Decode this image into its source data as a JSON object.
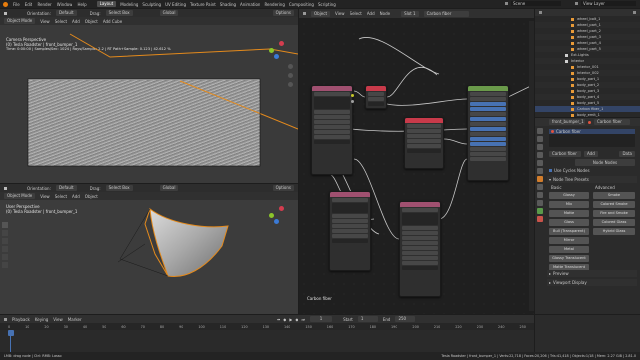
{
  "topbar": {
    "menus": [
      "File",
      "Edit",
      "Render",
      "Window",
      "Help"
    ],
    "workspaces": [
      "Layout",
      "Modeling",
      "Sculpting",
      "UV Editing",
      "Texture Paint",
      "Shading",
      "Animation",
      "Rendering",
      "Compositing",
      "Scripting"
    ],
    "active_workspace": "Layout",
    "scene": "Scene",
    "view_layer": "View Layer"
  },
  "viewport_top": {
    "orientation_label": "Orientation:",
    "orientation_value": "Default",
    "drag_label": "Drag:",
    "select_box": "Select Box",
    "global": "Global",
    "options": "Options",
    "mode": "Object Mode",
    "menus": [
      "View",
      "Select",
      "Add",
      "Object"
    ],
    "add_cube": "Add Cube",
    "camera_perspective": "Camera Perspective",
    "object_name": "(0) Tesla Roadster | front_bumper_1",
    "render_status": "Time: 0:00:00 | Samples/Sec: 1024 | Rays/Sample: 2.2 | RT Path+Sample: 0.123 | 42.612 %"
  },
  "viewport_bottom": {
    "orientation_label": "Orientation:",
    "orientation_value": "Default",
    "drag_label": "Drag:",
    "select_box": "Select Box",
    "global": "Global",
    "options": "Options",
    "mode": "Object Mode",
    "menus": [
      "View",
      "Select",
      "Add",
      "Object"
    ],
    "view_name": "User Perspective",
    "object_name": "(0) Tesla Roadster | front_bumper_1"
  },
  "node_editor": {
    "mode": "Object",
    "menus": [
      "View",
      "Select",
      "Add",
      "Node"
    ],
    "slot": "Slot 1",
    "material": "Carbon fiber",
    "frame_label": "Carbon fiber"
  },
  "outliner": {
    "items": [
      "wheel_bolt_1",
      "wheel_part_1",
      "wheel_part_2",
      "wheel_part_3",
      "wheel_part_4",
      "wheel_part_5",
      "Ext.Lights",
      "Interior",
      "Interior_001",
      "Interior_002",
      "body_part_1",
      "body_part_2",
      "body_part_3",
      "body_part_4",
      "body_part_5",
      "Carbon fiber_1",
      "body_emit_1",
      "body_part_6",
      "body_part_7",
      "glass_part_1",
      "glass_part_2"
    ]
  },
  "properties": {
    "object_name": "front_bumper_1",
    "material_name": "Carbon fiber",
    "add_label": "Add",
    "data_label": "Data",
    "new_node": "Node Nodes",
    "use_cycles": "Use Cycles Nodes",
    "section_title": "Node Tree Presets",
    "col_basic": "Basic",
    "col_advanced": "Advanced",
    "basic_buttons": [
      "Glossy",
      "Mix",
      "Matte",
      "Glass",
      "Bull (Transparent)",
      "Mirror",
      "Metal",
      "Glossy Translucent",
      "Matte Translucent"
    ],
    "advanced_buttons": [
      "Smoke",
      "Colored Smoke",
      "Fire and Smoke",
      "Colored Glass",
      "Hybrid Glass"
    ],
    "preview": "Preview",
    "viewport_display": "Viewport Display"
  },
  "timeline": {
    "menus": [
      "Playback",
      "Keying",
      "View",
      "Marker"
    ],
    "current_frame": "1",
    "start_label": "Start",
    "start": "1",
    "end_label": "End",
    "end": "250",
    "ticks": [
      "0",
      "10",
      "20",
      "30",
      "40",
      "50",
      "60",
      "70",
      "80",
      "90",
      "100",
      "110",
      "120",
      "130",
      "140",
      "150",
      "160",
      "170",
      "180",
      "190",
      "200",
      "210",
      "220",
      "230",
      "240",
      "250"
    ]
  },
  "statusbar": {
    "left": "LMB: drag node | Ctrl: RMB: Lasso",
    "right": "Tesla Roadster | front_bumper_1 | Verts:22,718 | Faces:20,206 | Tris:41,418 | Objects:1/18 | Mem: 2.27 GiB | 2.81.0"
  }
}
